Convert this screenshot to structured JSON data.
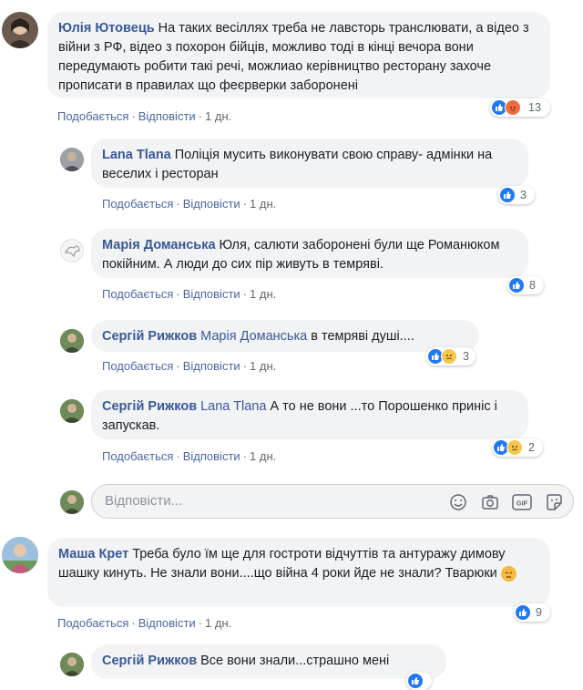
{
  "comments": [
    {
      "author": "Юлія Ютовець",
      "mention": "",
      "text": "На таких весіллях треба не лавсторь транслювати, а відео з війни з РФ, відео з похорон бійців, можливо тоді в кінці вечора вони передумають робити такі речі, можлиао керівництво ресторану захоче прописати в правилах що феєрверки заборонені",
      "like": "Подобається",
      "reply": "Відповісти",
      "time": "1 дн.",
      "reactions": [
        "like",
        "angry"
      ],
      "count": "13"
    },
    {
      "author": "Lana Tlana",
      "mention": "",
      "text": "Поліція мусить виконувати свою справу- адмінки на веселих і ресторан",
      "like": "Подобається",
      "reply": "Відповісти",
      "time": "1 дн.",
      "reactions": [
        "like"
      ],
      "count": "3"
    },
    {
      "author": "Марія Доманська",
      "mention": "",
      "text": "Юля, салюти заборонені були ще Романюком покійним. А люди до сих пір живуть в темряві.",
      "like": "Подобається",
      "reply": "Відповісти",
      "time": "1 дн.",
      "reactions": [
        "like"
      ],
      "count": "8"
    },
    {
      "author": "Сергій Рижков",
      "mention": "Марія Доманська",
      "text": "в темряві душі....",
      "like": "Подобається",
      "reply": "Відповісти",
      "time": "1 дн.",
      "reactions": [
        "like",
        "sad"
      ],
      "count": "3"
    },
    {
      "author": "Сергій Рижков",
      "mention": "Lana Tlana",
      "text": "А то не вони ...то Порошенко приніс і запускав.",
      "like": "Подобається",
      "reply": "Відповісти",
      "time": "1 дн.",
      "reactions": [
        "like",
        "sad"
      ],
      "count": "2"
    },
    {
      "author": "Маша Крет",
      "mention": "",
      "text": "Треба було їм ще для гостроти відчуттів та антуражу димову шашку кинуть. Не знали вони....що війна 4 роки йде не знали? Тварюки",
      "like": "Подобається",
      "reply": "Відповісти",
      "time": "1 дн.",
      "reactions": [
        "like"
      ],
      "count": "9"
    },
    {
      "author": "Сергій Рижков",
      "mention": "",
      "text": "Все вони знали...страшно мені",
      "like": "",
      "reply": "",
      "time": "",
      "reactions": [
        "like"
      ],
      "count": ""
    }
  ],
  "reply_box": {
    "placeholder": "Відповісти..."
  },
  "colors": {
    "link": "#385898",
    "bubble": "#f2f3f5",
    "like": "#2078f4"
  },
  "icons": [
    "emoji-icon",
    "camera-icon",
    "gif-icon",
    "sticker-icon",
    "like-reaction-icon",
    "angry-reaction-icon",
    "sad-reaction-icon"
  ]
}
